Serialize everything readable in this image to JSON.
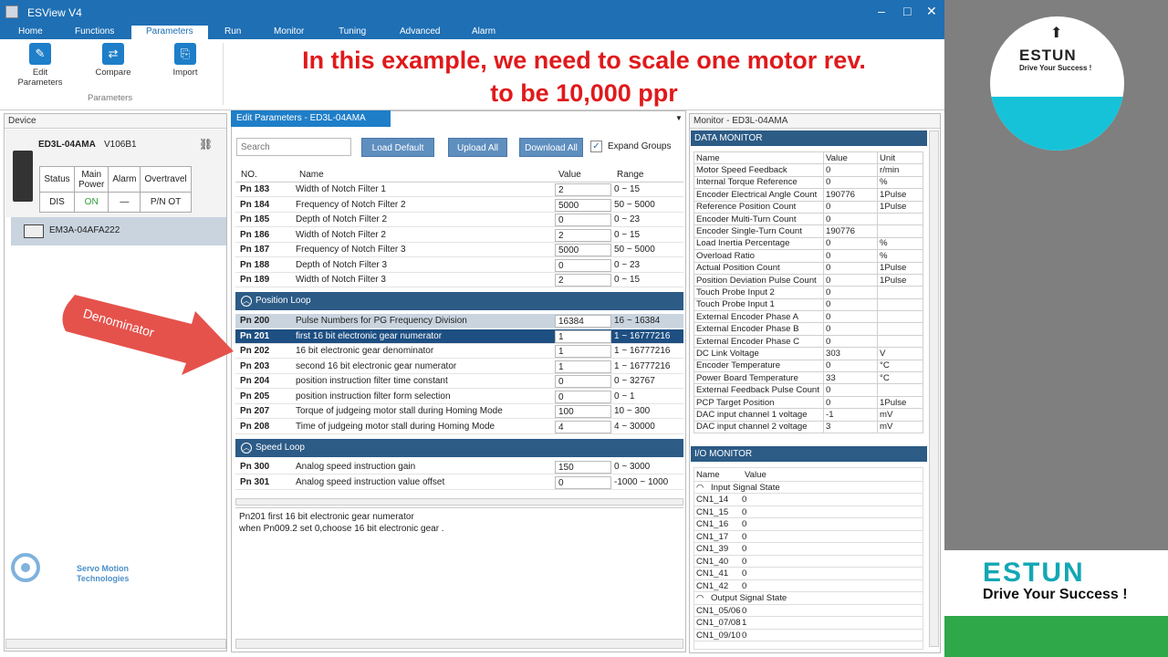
{
  "app": {
    "title": "ESView V4"
  },
  "menu": [
    "Home",
    "Functions",
    "Parameters",
    "Run",
    "Monitor",
    "Tuning",
    "Advanced",
    "Alarm"
  ],
  "ribbon": {
    "edit_l1": "Edit",
    "edit_l2": "Parameters",
    "compare": "Compare",
    "import": "Import",
    "group": "Parameters"
  },
  "overlay": {
    "line1": "In this example, we need to scale one motor rev.",
    "line2": "to be 10,000 ppr"
  },
  "callout": "Denominator",
  "device": {
    "panel_title": "Device",
    "model": "ED3L-04AMA",
    "version": "V106B1",
    "headers": [
      "Status",
      "Main Power",
      "Alarm",
      "Overtravel"
    ],
    "values": [
      "DIS",
      "ON",
      "—",
      "P/N OT"
    ],
    "motor": "EM3A-04AFA222"
  },
  "editor": {
    "tab": "Edit Parameters - ED3L-04AMA",
    "search_placeholder": "Search",
    "load_default": "Load Default",
    "upload_all": "Upload All",
    "download_all": "Download All",
    "expand_groups": "Expand Groups",
    "col_no": "NO.",
    "col_name": "Name",
    "col_value": "Value",
    "col_range": "Range"
  },
  "params_a": [
    {
      "no": "Pn 183",
      "name": "Width of Notch Filter 1",
      "value": "2",
      "range": "0 ~ 15"
    },
    {
      "no": "Pn 184",
      "name": "Frequency of Notch Filter 2",
      "value": "5000",
      "range": "50 ~ 5000"
    },
    {
      "no": "Pn 185",
      "name": "Depth of Notch Filter 2",
      "value": "0",
      "range": "0 ~ 23"
    },
    {
      "no": "Pn 186",
      "name": "Width of Notch Filter 2",
      "value": "2",
      "range": "0 ~ 15"
    },
    {
      "no": "Pn 187",
      "name": "Frequency of Notch Filter 3",
      "value": "5000",
      "range": "50 ~ 5000"
    },
    {
      "no": "Pn 188",
      "name": "Depth of Notch Filter 3",
      "value": "0",
      "range": "0 ~ 23"
    },
    {
      "no": "Pn 189",
      "name": "Width of Notch Filter 3",
      "value": "2",
      "range": "0 ~ 15"
    }
  ],
  "group_position": "Position Loop",
  "params_b": [
    {
      "no": "Pn 200",
      "name": "Pulse Numbers for PG Frequency Division",
      "value": "16384",
      "range": "16 ~ 16384"
    },
    {
      "no": "Pn 201",
      "name": "first 16 bit electronic gear numerator",
      "value": "1",
      "range": "1 ~ 16777216"
    },
    {
      "no": "Pn 202",
      "name": "16 bit electronic gear denominator",
      "value": "1",
      "range": "1 ~ 16777216"
    },
    {
      "no": "Pn 203",
      "name": "second 16 bit electronic gear numerator",
      "value": "1",
      "range": "1 ~ 16777216"
    },
    {
      "no": "Pn 204",
      "name": "position instruction filter time constant",
      "value": "0",
      "range": "0 ~ 32767"
    },
    {
      "no": "Pn 205",
      "name": "position instruction filter form selection",
      "value": "0",
      "range": "0 ~ 1"
    },
    {
      "no": "Pn 207",
      "name": "Torque of judgeing motor stall during Homing Mode",
      "value": "100",
      "range": "10 ~ 300"
    },
    {
      "no": "Pn 208",
      "name": "Time of judgeing motor stall during Homing Mode",
      "value": "4",
      "range": "4 ~ 30000"
    }
  ],
  "group_speed": "Speed Loop",
  "params_c": [
    {
      "no": "Pn 300",
      "name": "Analog speed instruction gain",
      "value": "150",
      "range": "0 ~ 3000"
    },
    {
      "no": "Pn 301",
      "name": "Analog speed instruction value offset",
      "value": "0",
      "range": "-1000 ~ 1000"
    }
  ],
  "desc": {
    "line1": "Pn201  first 16 bit electronic gear numerator",
    "line2": "when Pn009.2 set 0,choose 16 bit electronic gear ."
  },
  "monitor": {
    "panel_title": "Monitor - ED3L-04AMA",
    "data_title": "DATA MONITOR",
    "h_name": "Name",
    "h_value": "Value",
    "h_unit": "Unit",
    "rows": [
      [
        "Motor Speed Feedback",
        "0",
        "r/min"
      ],
      [
        "Internal Torque Reference",
        "0",
        "%"
      ],
      [
        "Encoder Electrical Angle Count",
        "190776",
        "1Pulse"
      ],
      [
        "Reference Position Count",
        "0",
        "1Pulse"
      ],
      [
        "Encoder Multi-Turn Count",
        "0",
        ""
      ],
      [
        "Encoder Single-Turn Count",
        "190776",
        ""
      ],
      [
        "Load Inertia Percentage",
        "0",
        "%"
      ],
      [
        "Overload Ratio",
        "0",
        "%"
      ],
      [
        "Actual Position Count",
        "0",
        "1Pulse"
      ],
      [
        "Position Deviation Pulse Count",
        "0",
        "1Pulse"
      ],
      [
        "Touch Probe Input 2",
        "0",
        ""
      ],
      [
        "Touch Probe Input 1",
        "0",
        ""
      ],
      [
        "External Encoder Phase A",
        "0",
        ""
      ],
      [
        "External Encoder Phase B",
        "0",
        ""
      ],
      [
        "External Encoder Phase C",
        "0",
        ""
      ],
      [
        "DC Link Voltage",
        "303",
        "V"
      ],
      [
        "Encoder Temperature",
        "0",
        "°C"
      ],
      [
        "Power Board Temperature",
        "33",
        "°C"
      ],
      [
        "External Feedback Pulse Count",
        "0",
        ""
      ],
      [
        "PCP  Target Position",
        "0",
        "1Pulse"
      ],
      [
        "DAC input channel 1 voltage",
        "-1",
        "mV"
      ],
      [
        "DAC input channel 2 voltage",
        "3",
        "mV"
      ]
    ],
    "io_title": "I/O MONITOR",
    "io_h_name": "Name",
    "io_h_value": "Value",
    "input_group": "Input Signal State",
    "output_group": "Output Signal State",
    "inputs": [
      [
        "CN1_14",
        "0"
      ],
      [
        "CN1_15",
        "0"
      ],
      [
        "CN1_16",
        "0"
      ],
      [
        "CN1_17",
        "0"
      ],
      [
        "CN1_39",
        "0"
      ],
      [
        "CN1_40",
        "0"
      ],
      [
        "CN1_41",
        "0"
      ],
      [
        "CN1_42",
        "0"
      ]
    ],
    "outputs": [
      [
        "CN1_05/06",
        "0"
      ],
      [
        "CN1_07/08",
        "1"
      ],
      [
        "CN1_09/10",
        "0"
      ]
    ]
  },
  "brand": {
    "logo_text": "ESTUN",
    "logo_sub": "Drive Your Success !",
    "card_text": "ESTUN",
    "card_sub": "Drive Your Success !",
    "watermark_1": "Servo Motion",
    "watermark_2": "Technologies"
  }
}
